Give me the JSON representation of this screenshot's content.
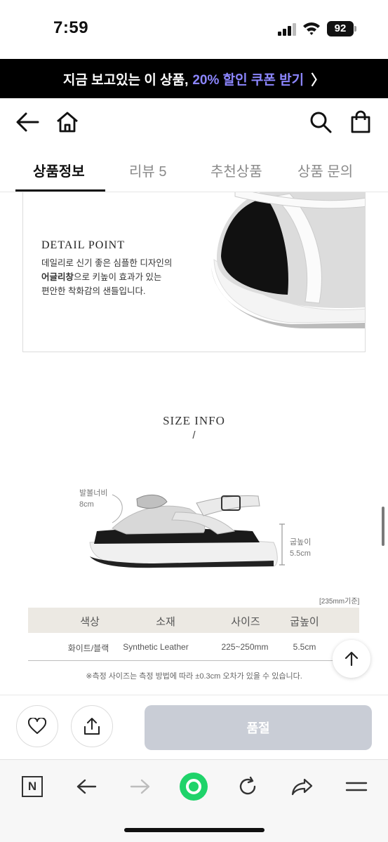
{
  "status_bar": {
    "time": "7:59",
    "battery": "92"
  },
  "promo": {
    "text": "지금 보고있는 이 상품,",
    "highlight": "20% 할인 쿠폰 받기",
    "chevron": "〉"
  },
  "header": {
    "icons": [
      "back-arrow-icon",
      "home-icon",
      "search-icon",
      "shopping-bag-icon"
    ]
  },
  "tabs": [
    {
      "label": "상품정보",
      "active": true
    },
    {
      "label": "리뷰 5",
      "active": false
    },
    {
      "label": "추천상품",
      "active": false
    },
    {
      "label": "상품 문의",
      "active": false
    }
  ],
  "detail": {
    "title": "DETAIL POINT",
    "line1": "데일리로 신기 좋은 심플한 디자인의",
    "line2_bold": "어글리창",
    "line2_rest": "으로 키높이 효과가 있는",
    "line3": "편안한 착화감의 샌들입니다."
  },
  "size_info": {
    "title": "SIZE INFO",
    "slash": "/",
    "width_label": "발볼너비",
    "width_value": "8cm",
    "heel_label": "굽높이",
    "heel_value": "5.5cm",
    "reference": "[235mm기준]",
    "table": {
      "headers": [
        "색상",
        "소재",
        "사이즈",
        "굽높이"
      ],
      "row": [
        "화이트/블랙",
        "Synthetic Leather",
        "225~250mm",
        "5.5cm"
      ]
    },
    "note": "※측정 사이즈는 측정 방법에 따라 ±0.3cm 오차가 있을 수 있습니다."
  },
  "action_bar": {
    "soldout_label": "품절",
    "icons": [
      "heart-icon",
      "share-icon"
    ]
  },
  "browser_bar": {
    "n_label": "N",
    "icons": [
      "naver-n-icon",
      "back-icon",
      "forward-icon",
      "green-home-icon",
      "reload-icon",
      "share-arrow-icon",
      "menu-icon"
    ]
  },
  "colors": {
    "promo_bg": "#000000",
    "promo_highlight": "#8c86ff",
    "soldout_bg": "#c9cdd6",
    "table_head_bg": "#ece9e3",
    "green": "#1fd36a"
  }
}
